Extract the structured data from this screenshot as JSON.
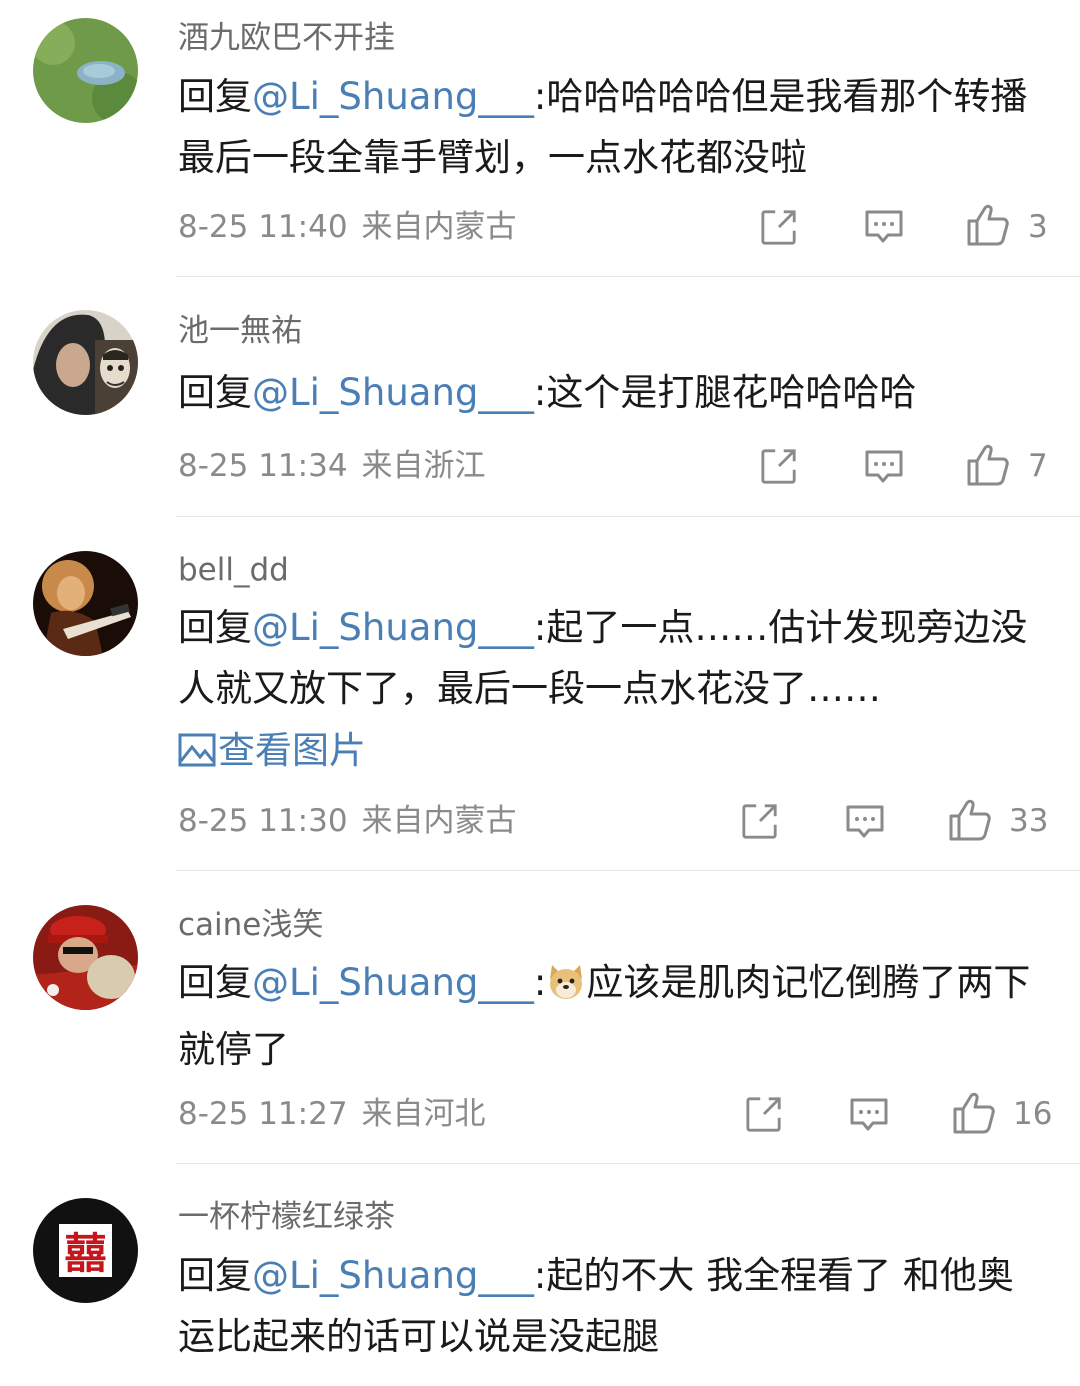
{
  "comments": [
    {
      "user": "酒九欧巴不开挂",
      "reply_prefix": "回复",
      "mention": "@Li_Shuang___",
      "text": ":哈哈哈哈哈但是我看那个转播最后一段全靠手臂划，一点水花都没啦",
      "time": "8-25 11:40",
      "location": "来自内蒙古",
      "likes": "3"
    },
    {
      "user": "池一無祐",
      "reply_prefix": "回复",
      "mention": "@Li_Shuang___",
      "text": ":这个是打腿花哈哈哈哈",
      "time": "8-25 11:34",
      "location": "来自浙江",
      "likes": "7"
    },
    {
      "user": "bell_dd",
      "reply_prefix": "回复",
      "mention": "@Li_Shuang___",
      "text": ":起了一点……估计发现旁边没人就又放下了，最后一段一点水花没了……",
      "see_picture": "查看图片",
      "time": "8-25 11:30",
      "location": "来自内蒙古",
      "likes": "33"
    },
    {
      "user": "caine浅笑",
      "reply_prefix": "回复",
      "mention": "@Li_Shuang___",
      "text_before_emoji": ":",
      "text": "应该是肌肉记忆倒腾了两下就停了",
      "time": "8-25 11:27",
      "location": "来自河北",
      "likes": "16"
    },
    {
      "user": "一杯柠檬红绿茶",
      "reply_prefix": "回复",
      "mention": "@Li_Shuang___",
      "text": ":起的不大 我全程看了 和他奥运比起来的话可以说是没起腿"
    }
  ],
  "icons": {
    "share": "share-icon",
    "comment": "comment-icon",
    "like": "thumbs-up-icon"
  },
  "colors": {
    "mention": "#4a7fb5",
    "meta": "#8a8a8a",
    "username": "#6b6b6b"
  }
}
